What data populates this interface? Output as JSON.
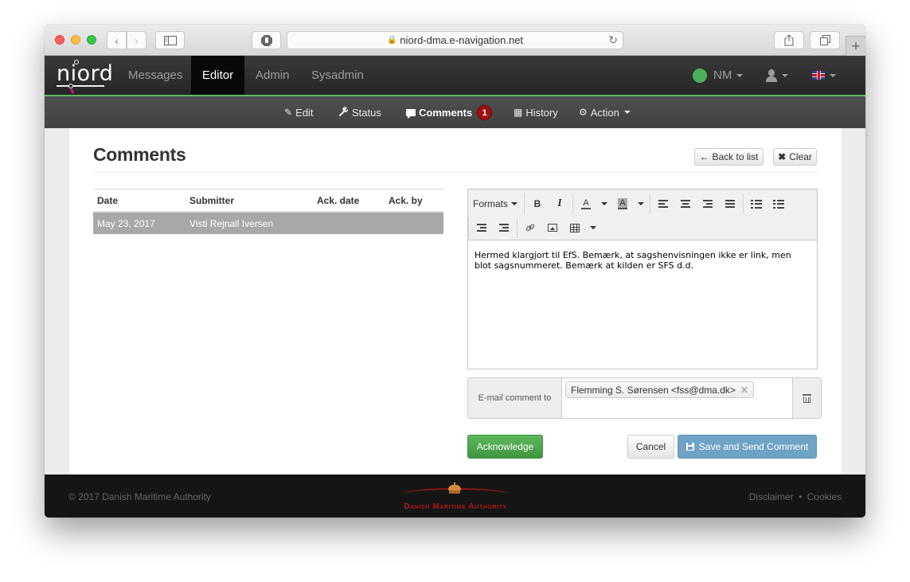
{
  "browser": {
    "url": "niord-dma.e-navigation.net",
    "lock_icon": "lock-icon",
    "back_glyph": "‹",
    "forward_glyph": "›",
    "newtab_glyph": "+"
  },
  "navbar": {
    "logo_text": "niord",
    "items": [
      {
        "label": "Messages",
        "active": false
      },
      {
        "label": "Editor",
        "active": true
      },
      {
        "label": "Admin",
        "active": false
      },
      {
        "label": "Sysadmin",
        "active": false
      }
    ],
    "domain_menu": "NM",
    "status_color": "#4caf5a",
    "accent_color": "#5cb85c"
  },
  "subnav": {
    "items": [
      {
        "label": "Edit",
        "icon": "pencil-icon",
        "glyph": "✎"
      },
      {
        "label": "Status",
        "icon": "wrench-icon",
        "glyph": "🔧"
      },
      {
        "label": "Comments",
        "icon": "comment-icon",
        "badge": "1",
        "active": true
      },
      {
        "label": "History",
        "icon": "calendar-icon",
        "glyph": "▦"
      },
      {
        "label": "Action",
        "icon": "gear-icon",
        "glyph": "⚙"
      }
    ]
  },
  "page": {
    "title": "Comments",
    "back_button": "Back to list",
    "back_glyph": "🡐",
    "clear_button": "Clear",
    "clear_glyph": "✖"
  },
  "comments_table": {
    "columns": [
      "Date",
      "Submitter",
      "Ack. date",
      "Ack. by"
    ],
    "rows": [
      {
        "date": "May 23, 2017",
        "submitter": "Visti Rejnall Iversen",
        "ack_date": "",
        "ack_by": "",
        "selected": true
      }
    ]
  },
  "editor": {
    "toolbar": {
      "formats": "Formats",
      "bold": "B",
      "italic": "I",
      "text_color": "A",
      "bg_color": "A"
    },
    "content": "Hermed klargjort til EfS. Bemærk, at sagshenvisningen ikke er link, men blot sagsnummeret. Bemærk at kilden er SFS d.d."
  },
  "email": {
    "label": "E-mail comment to",
    "recipients": [
      "Flemming S. Sørensen <fss@dma.dk>"
    ],
    "remove_glyph": "✕"
  },
  "actions": {
    "acknowledge": "Acknowledge",
    "cancel": "Cancel",
    "save_send": "Save and Send Comment"
  },
  "footer": {
    "copyright": "© 2017 Danish Maritime Authority",
    "logo_text": "Danish Maritime Authority",
    "links": [
      "Disclaimer",
      "Cookies"
    ],
    "separator": "•"
  }
}
